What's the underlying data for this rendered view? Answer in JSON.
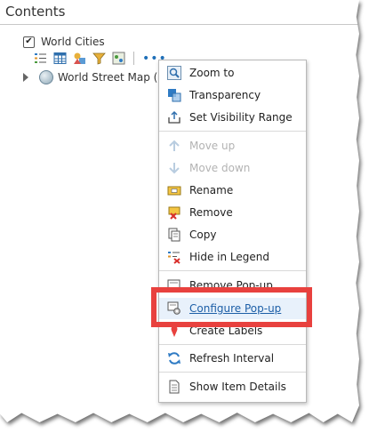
{
  "panel": {
    "title": "Contents"
  },
  "layer": {
    "name": "World Cities",
    "checked": "✔"
  },
  "toolbar": {
    "more": "•••"
  },
  "sublayer": {
    "name": "World Street Map ("
  },
  "menu": {
    "items": [
      {
        "label": "Zoom to",
        "icon": "zoom-to-icon"
      },
      {
        "label": "Transparency",
        "icon": "transparency-icon"
      },
      {
        "label": "Set Visibility Range",
        "icon": "visibility-range-icon"
      },
      {
        "label": "Move up",
        "icon": "arrow-up-icon",
        "disabled": true
      },
      {
        "label": "Move down",
        "icon": "arrow-down-icon",
        "disabled": true
      },
      {
        "label": "Rename",
        "icon": "rename-icon"
      },
      {
        "label": "Remove",
        "icon": "remove-icon"
      },
      {
        "label": "Copy",
        "icon": "copy-icon"
      },
      {
        "label": "Hide in Legend",
        "icon": "hide-legend-icon"
      },
      {
        "label": "Remove Pop-up",
        "icon": "remove-popup-icon"
      },
      {
        "label": "Configure Pop-up",
        "icon": "configure-popup-icon",
        "highlighted": true
      },
      {
        "label": "Create Labels",
        "icon": "create-labels-icon"
      },
      {
        "label": "Refresh Interval",
        "icon": "refresh-icon"
      },
      {
        "label": "Show Item Details",
        "icon": "item-details-icon"
      }
    ]
  },
  "colors": {
    "callout": "#e8413e",
    "link": "#1d5fa7",
    "accent": "#1e6fb8"
  }
}
